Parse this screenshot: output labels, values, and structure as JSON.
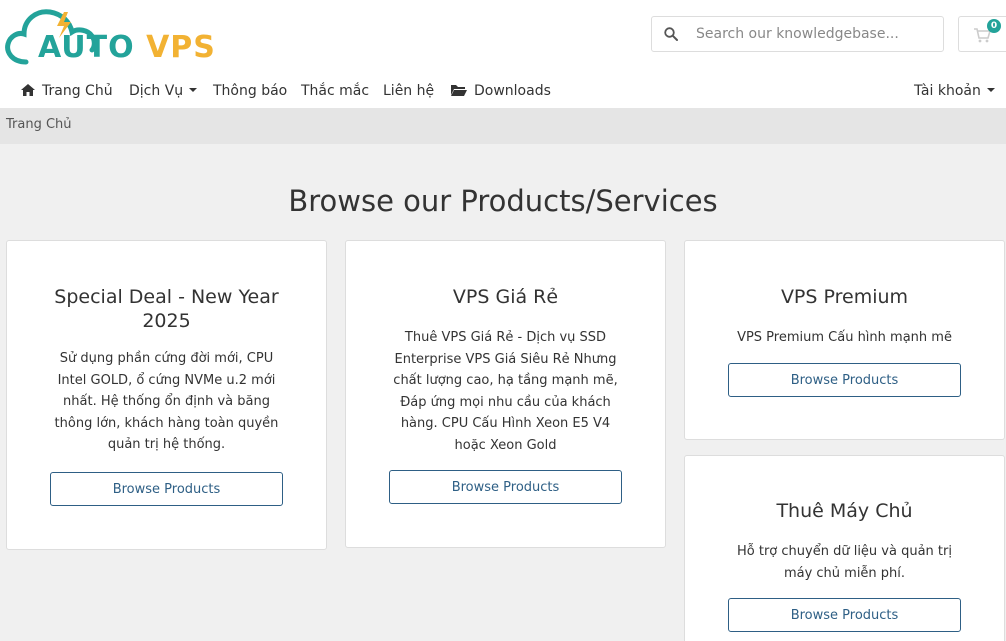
{
  "brand": {
    "part1": "AUTO",
    "part2": "VPS"
  },
  "search": {
    "placeholder": "Search our knowledgebase..."
  },
  "cart": {
    "count": "0"
  },
  "nav": {
    "home": "Trang Chủ",
    "services": "Dịch Vụ",
    "announcements": "Thông báo",
    "faq": "Thắc mắc",
    "contact": "Liên hệ",
    "downloads": "Downloads",
    "account": "Tài khoản"
  },
  "breadcrumb": "Trang Chủ",
  "page_title": "Browse our Products/Services",
  "cards": [
    {
      "title_line1": "Special Deal - New Year",
      "title_line2": "2025",
      "desc": [
        "Sử dụng phần cứng đời mới, CPU",
        "Intel GOLD, ổ cứng NVMe u.2 mới",
        "nhất. Hệ thống ổn định và băng",
        "thông lớn, khách hàng toàn quyền",
        "quản trị hệ thống."
      ],
      "button": "Browse Products"
    },
    {
      "title_line1": "VPS Giá Rẻ",
      "desc": [
        "Thuê VPS Giá Rẻ - Dịch vụ SSD",
        "Enterprise VPS Giá Siêu Rẻ Nhưng",
        "chất lượng cao, hạ tầng mạnh mẽ,",
        "Đáp ứng mọi nhu cầu của khách",
        "hàng. CPU Cấu Hình Xeon E5 V4",
        "hoặc Xeon Gold"
      ],
      "button": "Browse Products"
    },
    {
      "title_line1": "VPS Premium",
      "desc": [
        "VPS Premium Cấu hình mạnh mẽ"
      ],
      "button": "Browse Products"
    },
    {
      "title_line1": "Thuê Máy Chủ",
      "desc": [
        "Hỗ trợ chuyển dữ liệu và quản trị",
        "máy chủ miễn phí."
      ],
      "button": "Browse Products"
    }
  ],
  "colors": {
    "teal": "#23a39a",
    "yellow": "#f2b233",
    "button_border": "#2e5f85"
  }
}
